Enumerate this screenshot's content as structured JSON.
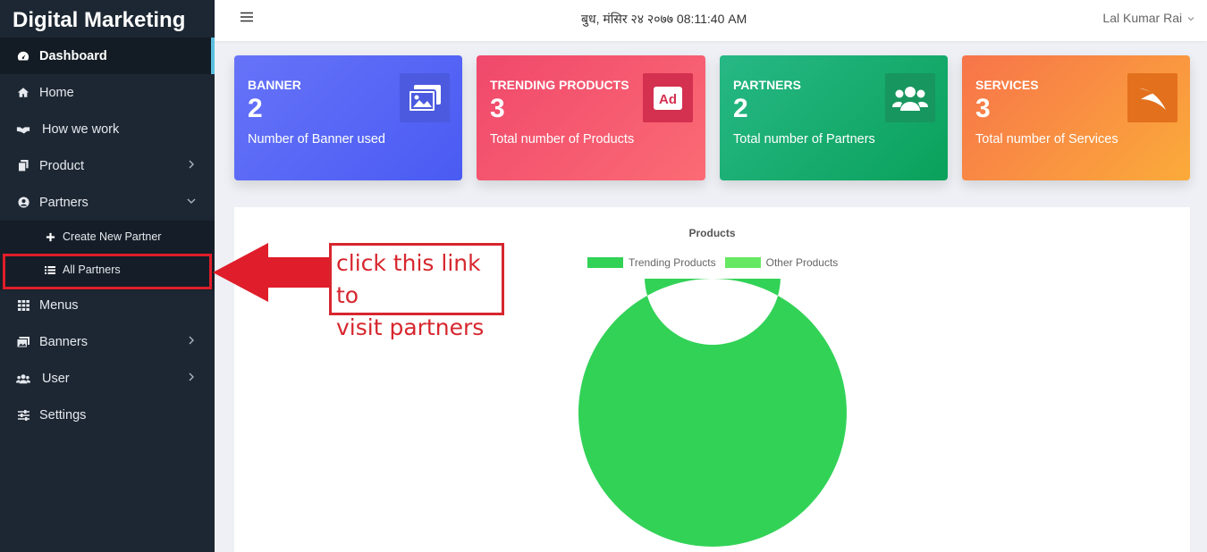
{
  "sidebar": {
    "brand": "Digital Marketing",
    "items": [
      {
        "label": "Dashboard",
        "icon": "dashboard-icon"
      },
      {
        "label": "Home",
        "icon": "home-icon"
      },
      {
        "label": "How we work",
        "icon": "handshake-icon"
      },
      {
        "label": "Product",
        "icon": "copy-icon"
      },
      {
        "label": "Partners",
        "icon": "user-circle-icon"
      },
      {
        "label": "Menus",
        "icon": "grid-icon"
      },
      {
        "label": "Banners",
        "icon": "images-icon"
      },
      {
        "label": "User",
        "icon": "users-icon"
      },
      {
        "label": "Settings",
        "icon": "sliders-icon"
      }
    ],
    "partners_sub": [
      {
        "label": "Create New Partner",
        "icon": "plus-icon"
      },
      {
        "label": "All Partners",
        "icon": "list-icon"
      }
    ]
  },
  "topbar": {
    "datetime": "बुध, मंसिर २४ २०७७ 08:11:40 AM",
    "user": "Lal Kumar Rai"
  },
  "cards": {
    "banner": {
      "title": "BANNER",
      "value": "2",
      "desc": "Number of Banner used",
      "icon": "images-icon"
    },
    "trending": {
      "title": "TRENDING PRODUCTS",
      "value": "3",
      "desc": "Total number of Products",
      "icon": "ad-icon"
    },
    "partners": {
      "title": "PARTNERS",
      "value": "2",
      "desc": "Total number of Partners",
      "icon": "users-icon"
    },
    "services": {
      "title": "SERVICES",
      "value": "3",
      "desc": "Total number of Services",
      "icon": "paper-plane-icon"
    }
  },
  "chart": {
    "title": "Products",
    "legend": [
      "Trending Products",
      "Other Products"
    ]
  },
  "chart_data": {
    "type": "pie",
    "title": "Products",
    "categories": [
      "Trending Products",
      "Other Products"
    ],
    "values": [
      3,
      0
    ],
    "colors": [
      "#32d257",
      "#66e862"
    ],
    "legend_position": "top"
  },
  "annotation": {
    "line1": "click this link to",
    "line2": "visit partners"
  }
}
